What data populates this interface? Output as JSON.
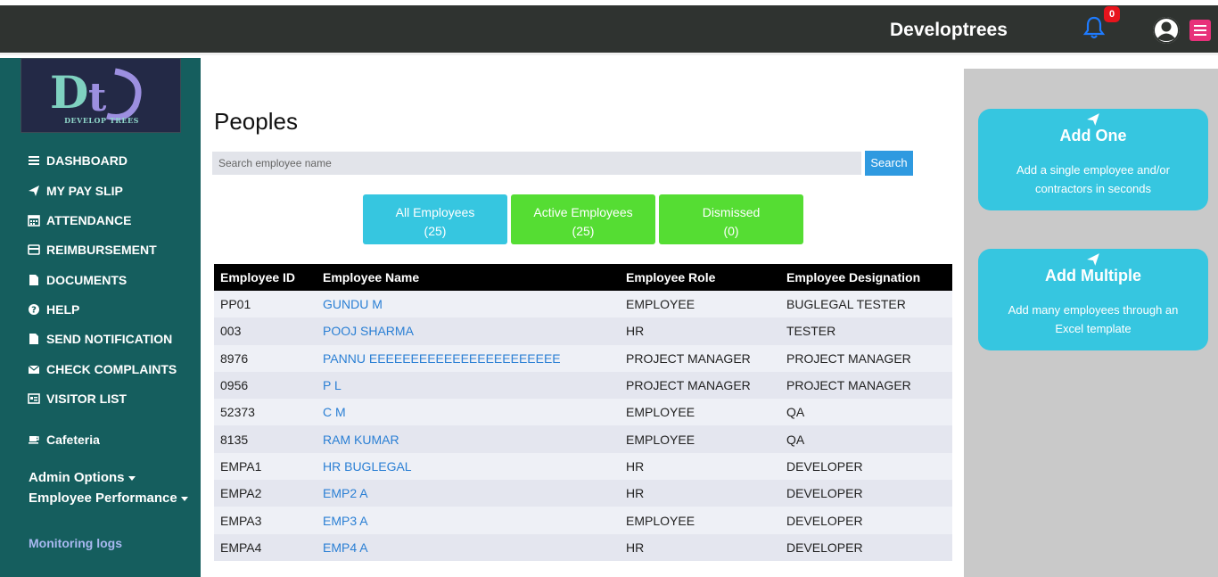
{
  "header": {
    "brand": "Developtrees",
    "notification_count": "0"
  },
  "sidebar": {
    "logo_text": "DEVELOP TREES",
    "items": [
      {
        "label": "DASHBOARD",
        "icon": "bars-icon"
      },
      {
        "label": "MY PAY SLIP",
        "icon": "paper-plane-icon"
      },
      {
        "label": "ATTENDANCE",
        "icon": "calendar-icon"
      },
      {
        "label": "REIMBURSEMENT",
        "icon": "credit-card-icon"
      },
      {
        "label": "DOCUMENTS",
        "icon": "file-icon"
      },
      {
        "label": "HELP",
        "icon": "question-circle-icon"
      },
      {
        "label": "SEND NOTIFICATION",
        "icon": "file-icon"
      },
      {
        "label": "CHECK COMPLAINTS",
        "icon": "envelope-icon"
      },
      {
        "label": "VISITOR LIST",
        "icon": "id-card-icon"
      }
    ],
    "cafeteria": "Cafeteria",
    "admin_options": "Admin Options",
    "employee_performance": "Employee Performance",
    "monitoring_logs": "Monitoring logs"
  },
  "main": {
    "title": "Peoples",
    "search": {
      "placeholder": "Search employee name",
      "value": "",
      "button": "Search"
    },
    "filters": [
      {
        "label": "All Employees",
        "count": "(25)",
        "color": "#36c6e0"
      },
      {
        "label": "Active Employees",
        "count": "(25)",
        "color": "#55dd33"
      },
      {
        "label": "Dismissed",
        "count": "(0)",
        "color": "#55dd33"
      }
    ],
    "table": {
      "headers": [
        "Employee ID",
        "Employee Name",
        "Employee Role",
        "Employee Designation"
      ],
      "rows": [
        [
          "PP01",
          "GUNDU M",
          "EMPLOYEE",
          "BUGLEGAL TESTER"
        ],
        [
          "003",
          "POOJ SHARMA",
          "HR",
          "TESTER"
        ],
        [
          "8976",
          "PANNU EEEEEEEEEEEEEEEEEEEEEEE",
          "PROJECT MANAGER",
          "PROJECT MANAGER"
        ],
        [
          "0956",
          "P L",
          "PROJECT MANAGER",
          "PROJECT MANAGER"
        ],
        [
          "52373",
          "C M",
          "EMPLOYEE",
          "QA"
        ],
        [
          "8135",
          "RAM KUMAR",
          "EMPLOYEE",
          "QA"
        ],
        [
          "EMPA1",
          "HR BUGLEGAL",
          "HR",
          "DEVELOPER"
        ],
        [
          "EMPA2",
          "EMP2 A",
          "HR",
          "DEVELOPER"
        ],
        [
          "EMPA3",
          "EMP3 A",
          "EMPLOYEE",
          "DEVELOPER"
        ],
        [
          "EMPA4",
          "EMP4 A",
          "HR",
          "DEVELOPER"
        ]
      ]
    }
  },
  "right_panel": {
    "cards": [
      {
        "title": "Add One",
        "desc": "Add a single employee and/or contractors in seconds"
      },
      {
        "title": "Add Multiple",
        "desc": "Add many employees through an Excel template"
      }
    ]
  },
  "colors": {
    "topbar": "#2f3330",
    "sidebar": "#155e5e",
    "accent_blue": "#36c6e0",
    "accent_green": "#55dd33",
    "link": "#2a7fd4",
    "badge": "#e8141c"
  }
}
